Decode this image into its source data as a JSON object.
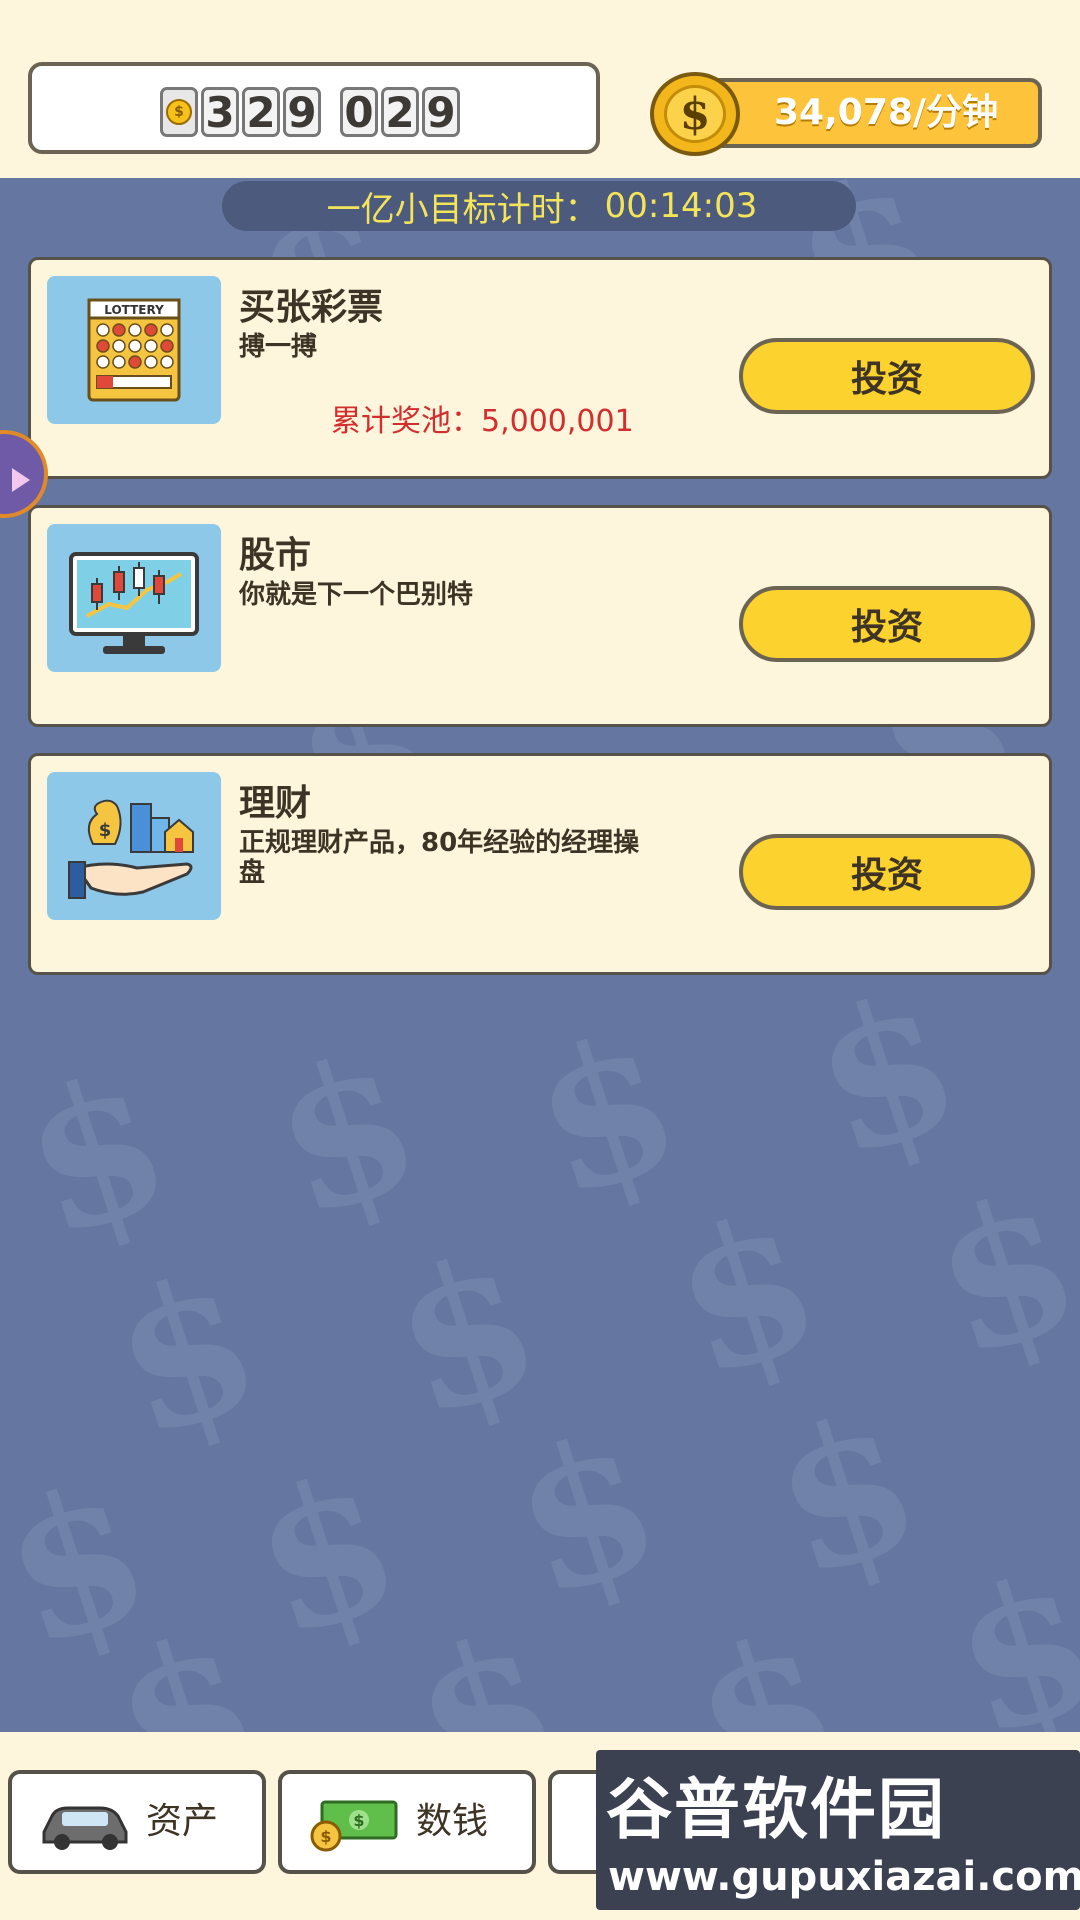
{
  "header": {
    "counter_digits_a": [
      "3",
      "2",
      "9"
    ],
    "counter_digits_b": [
      "0",
      "2",
      "9"
    ],
    "rate_text": "34,078/分钟"
  },
  "timer": {
    "label": "一亿小目标计时：",
    "value": "00:14:03"
  },
  "investments": [
    {
      "title": "买张彩票",
      "description": "搏一搏",
      "pool_label": "累计奖池：",
      "pool_value": "5,000,001",
      "button": "投资",
      "icon": "lottery-ticket-icon"
    },
    {
      "title": "股市",
      "description": "你就是下一个巴别特",
      "button": "投资",
      "icon": "stock-chart-icon"
    },
    {
      "title": "理财",
      "description": "正规理财产品，80年经验的经理操盘",
      "button": "投资",
      "icon": "finance-hand-icon"
    }
  ],
  "bottom_nav": [
    {
      "label": "资产",
      "icon": "car-icon"
    },
    {
      "label": "数钱",
      "icon": "money-icon"
    }
  ],
  "watermark": {
    "logo": "谷普软件园",
    "url": "www.gupuxiazai.com"
  },
  "colors": {
    "background": "#6577a0",
    "panel": "#fdf5dc",
    "button": "#fcd22e",
    "pool_text": "#d42d2d",
    "timer_text": "#f3e45a"
  }
}
